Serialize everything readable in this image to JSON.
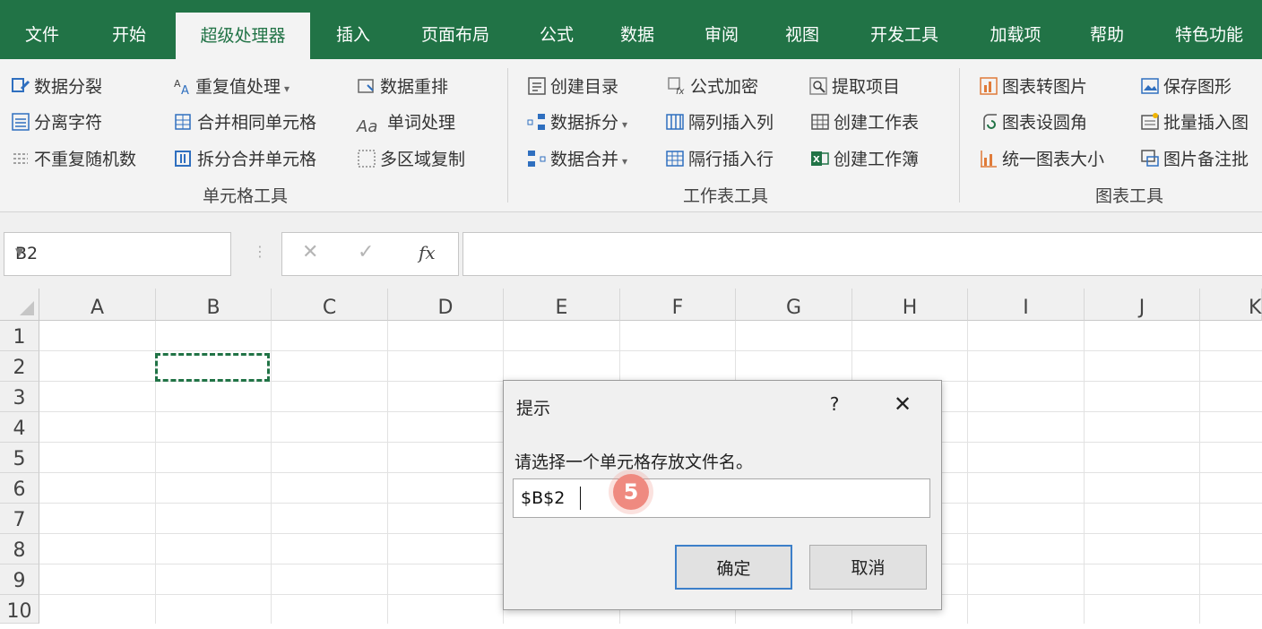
{
  "ribbon_tabs": [
    "文件",
    "开始",
    "超级处理器",
    "插入",
    "页面布局",
    "公式",
    "数据",
    "审阅",
    "视图",
    "开发工具",
    "加载项",
    "帮助",
    "特色功能"
  ],
  "active_tab": "超级处理器",
  "groups": {
    "cell_tools": {
      "label": "单元格工具",
      "items": [
        "数据分裂",
        "重复值处理",
        "数据重排",
        "分离字符",
        "合并相同单元格",
        "单词处理",
        "不重复随机数",
        "拆分合并单元格",
        "多区域复制"
      ]
    },
    "sheet_tools": {
      "label": "工作表工具",
      "items": [
        "创建目录",
        "公式加密",
        "提取项目",
        "数据拆分",
        "隔列插入列",
        "创建工作表",
        "数据合并",
        "隔行插入行",
        "创建工作簿"
      ]
    },
    "chart_tools": {
      "label": "图表工具",
      "items": [
        "图表转图片",
        "保存图形",
        "图表设圆角",
        "批量插入图",
        "统一图表大小",
        "图片备注批"
      ]
    }
  },
  "formula_bar": {
    "name_box": "B2",
    "fx": "fx",
    "cancel": "✕",
    "enter": "✓",
    "formula": ""
  },
  "columns": [
    "A",
    "B",
    "C",
    "D",
    "E",
    "F",
    "G",
    "H",
    "I",
    "J",
    "K"
  ],
  "rows": [
    "1",
    "2",
    "3",
    "4",
    "5",
    "6",
    "7",
    "8",
    "9",
    "10"
  ],
  "dialog": {
    "title": "提示",
    "help": "?",
    "close": "✕",
    "prompt": "请选择一个单元格存放文件名。",
    "input_value": "$B$2",
    "ok_label": "确定",
    "cancel_label": "取消"
  },
  "step_badge": "5",
  "colors": {
    "accent": "#217346",
    "marquee": "#217346",
    "badge": "#ef8a80"
  }
}
